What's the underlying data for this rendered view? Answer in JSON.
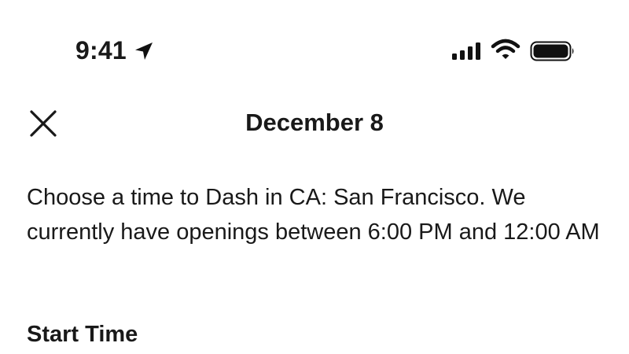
{
  "status_bar": {
    "time": "9:41",
    "icons": [
      "location-arrow-icon",
      "cellular-signal-icon",
      "wifi-icon",
      "battery-icon"
    ]
  },
  "header": {
    "close_icon": "close-icon",
    "title": "December 8"
  },
  "main": {
    "description": "Choose a time to Dash in CA: San Francisco. We currently have openings between 6:00 PM and 12:00 AM",
    "section_label": "Start Time"
  },
  "colors": {
    "text": "#191919",
    "background": "#ffffff"
  }
}
